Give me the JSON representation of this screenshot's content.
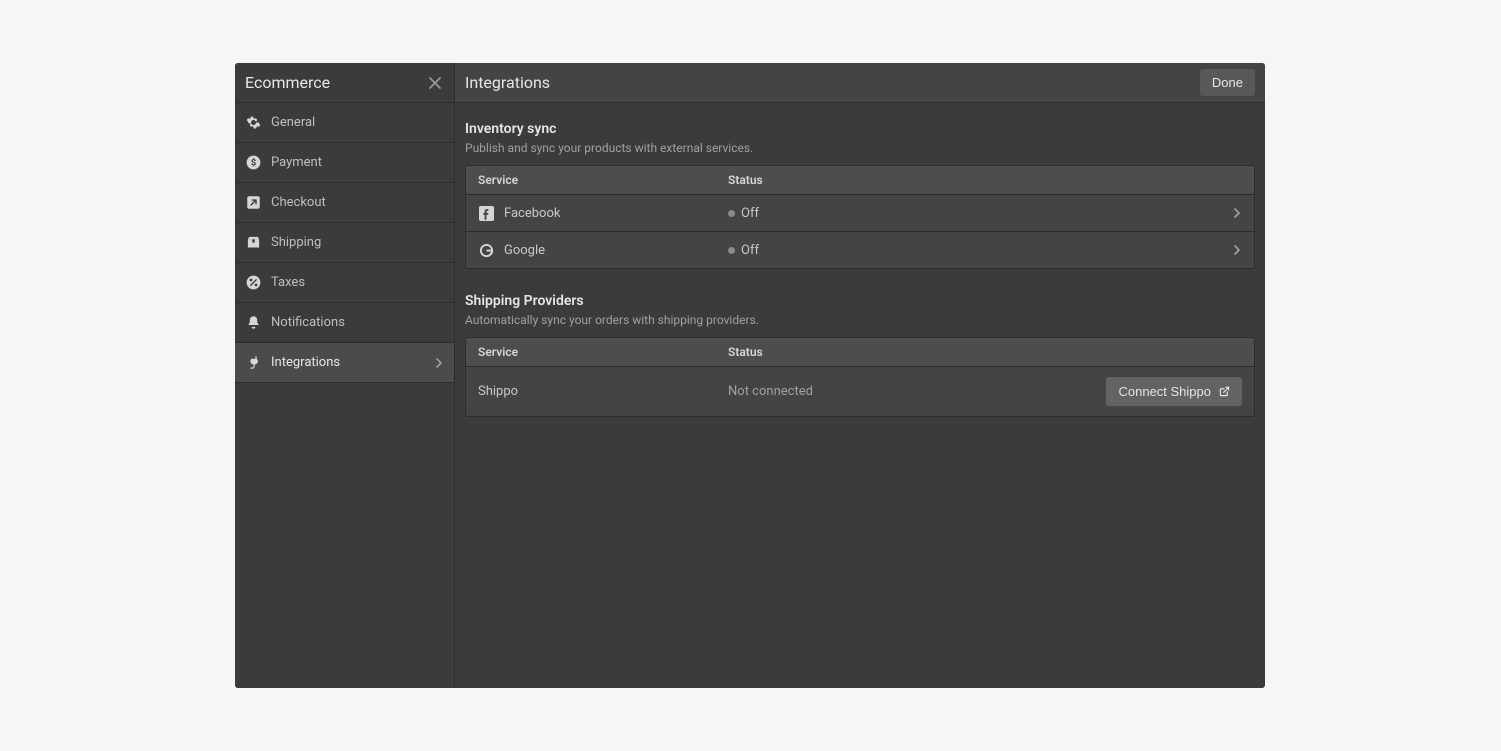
{
  "sidebar": {
    "title": "Ecommerce",
    "items": [
      {
        "label": "General"
      },
      {
        "label": "Payment"
      },
      {
        "label": "Checkout"
      },
      {
        "label": "Shipping"
      },
      {
        "label": "Taxes"
      },
      {
        "label": "Notifications"
      },
      {
        "label": "Integrations"
      }
    ]
  },
  "header": {
    "title": "Integrations",
    "done": "Done"
  },
  "sections": {
    "inventory": {
      "title": "Inventory sync",
      "desc": "Publish and sync your products with external services.",
      "col_service": "Service",
      "col_status": "Status",
      "rows": [
        {
          "name": "Facebook",
          "status": "Off"
        },
        {
          "name": "Google",
          "status": "Off"
        }
      ]
    },
    "shipping": {
      "title": "Shipping Providers",
      "desc": "Automatically sync your orders with shipping providers.",
      "col_service": "Service",
      "col_status": "Status",
      "rows": [
        {
          "name": "Shippo",
          "status": "Not connected",
          "action": "Connect Shippo"
        }
      ]
    }
  }
}
